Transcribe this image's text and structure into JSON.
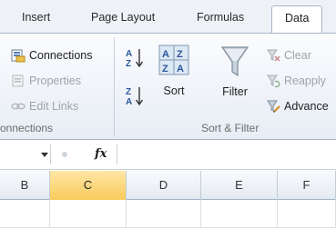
{
  "tabs": {
    "insert": "Insert",
    "page_layout": "Page Layout",
    "formulas": "Formulas",
    "data": "Data"
  },
  "connections_group": {
    "connections": "Connections",
    "properties": "Properties",
    "edit_links": "Edit Links",
    "label": "onnections"
  },
  "sort_filter_group": {
    "sort": "Sort",
    "filter": "Filter",
    "clear": "Clear",
    "reapply": "Reapply",
    "advanced": "Advance",
    "label": "Sort & Filter"
  },
  "formula_bar": {
    "fx": "fx",
    "name_value": "",
    "formula_value": ""
  },
  "columns": [
    "B",
    "C",
    "D",
    "E",
    "F"
  ],
  "active_column": "C",
  "colors": {
    "accent": "#2b579a",
    "active_col": "#f8cb5a",
    "funnel": "#8a9aab"
  }
}
